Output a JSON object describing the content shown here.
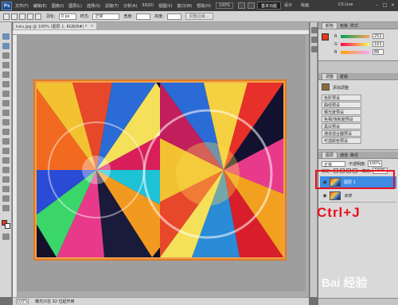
{
  "app": {
    "logo": "Ps",
    "menus": [
      "文件(F)",
      "编辑(E)",
      "图像(I)",
      "图层(L)",
      "选择(S)",
      "滤镜(T)",
      "分析(A)",
      "3D(D)",
      "视图(V)",
      "窗口(W)",
      "帮助(H)"
    ],
    "zoom": "100%",
    "workspaces": {
      "basic": "基本功能",
      "design": "设计",
      "draw": "绘画"
    },
    "cs_live": "CS Live"
  },
  "options": {
    "feather_label": "羽化:",
    "feather_value": "0 px",
    "style_label": "样式:",
    "style_value": "正常",
    "width_label": "宽度:",
    "height_label": "高度:",
    "refine_edge": "调整边缘..."
  },
  "document": {
    "tab_title": "tutu.jpg @ 100% (图层 1, RGB/8#) *",
    "zoom": "100%",
    "status_text": "曝光只在 32 位起作用"
  },
  "panels": {
    "color_tabs": [
      "颜色",
      "色板",
      "样式"
    ],
    "color_rows": [
      {
        "label": "R",
        "value": "252"
      },
      {
        "label": "G",
        "value": "163"
      },
      {
        "label": "B",
        "value": "88"
      }
    ],
    "adjust_tabs": [
      "调整",
      "蒙版"
    ],
    "adjust_title": "添加调整",
    "adjust_presets": [
      "色阶预设",
      "曲线预设",
      "曝光度预设",
      "色相/饱和度预设",
      "黑白预设",
      "通道混合器预设",
      "可选颜色预设"
    ],
    "layers_tabs": [
      "图层",
      "通道",
      "路径"
    ],
    "blend_mode": "正常",
    "opacity_label": "不透明度:",
    "opacity_value": "100%",
    "lock_label": "锁定:",
    "fill_label": "填充:",
    "fill_value": "100%",
    "layers": [
      {
        "name": "图层 1",
        "selected": true
      },
      {
        "name": "背景",
        "selected": false
      }
    ]
  },
  "annotation": {
    "shortcut": "Ctrl+J",
    "watermark": "Bai 经验"
  },
  "colors": {
    "highlight": "#e8101e",
    "selected_layer": "#3d8be3",
    "frame": "#f0a050"
  }
}
